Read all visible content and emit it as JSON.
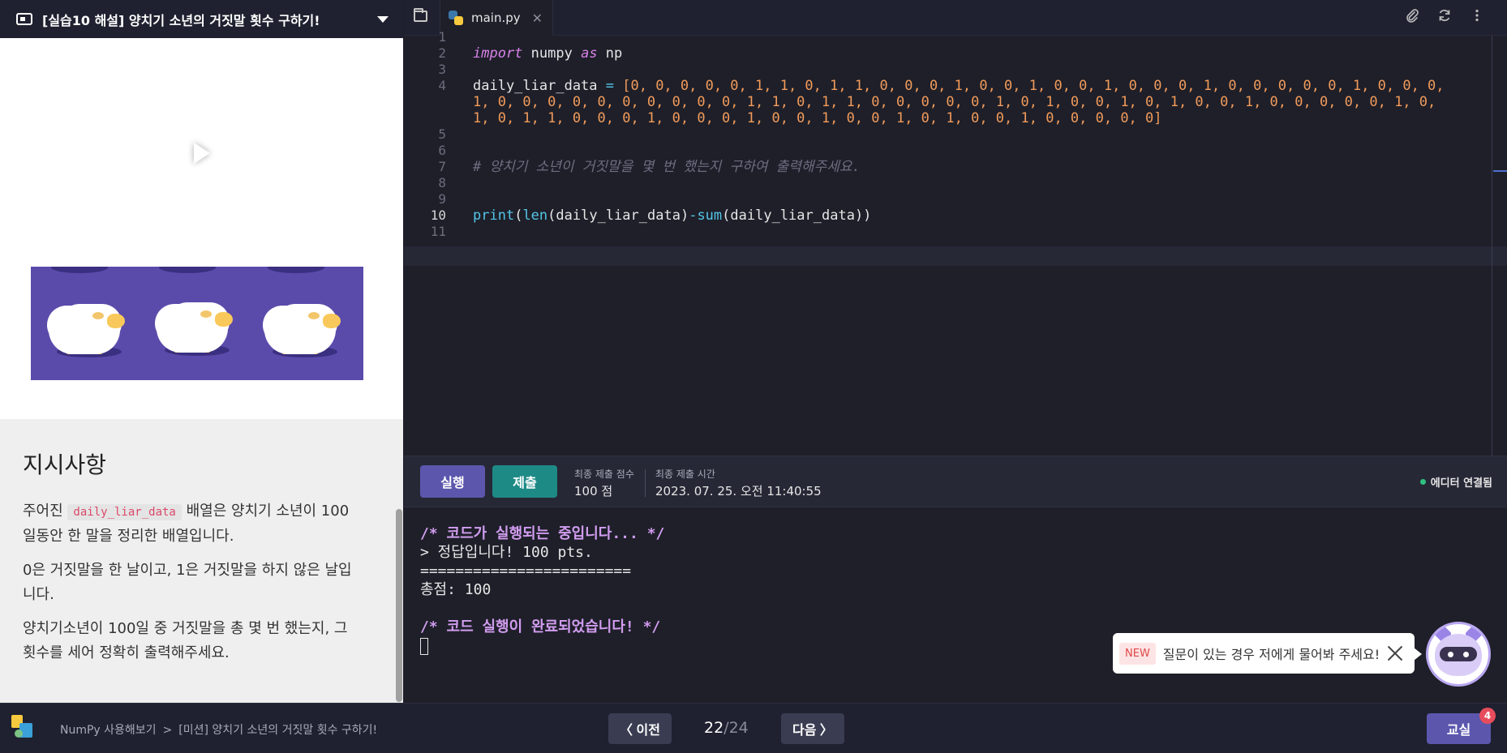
{
  "lesson": {
    "title": "[실습10 해설] 양치기 소년의 거짓말 횟수 구하기!"
  },
  "instructions": {
    "heading": "지시사항",
    "p1_before": "주어진",
    "p1_code": "daily_liar_data",
    "p1_after": "배열은 양치기 소년이 100일동안 한 말을 정리한 배열입니다.",
    "p2": "0은 거짓말을 한 날이고, 1은 거짓말을 하지 않은 날입니다.",
    "p3": "양치기소년이 100일 중 거짓말을 총 몇 번 했는지, 그 횟수를 세어 정확히 출력해주세요."
  },
  "editor": {
    "tab_label": "main.py",
    "tab_close": "✕",
    "line_numbers": [
      "1",
      "2",
      "3",
      "4",
      "5",
      "6",
      "7",
      "8",
      "9",
      "10",
      "11"
    ],
    "active_line": "10",
    "import_kw": "import",
    "module": " numpy ",
    "as_kw": "as",
    "alias": " np",
    "data_var": "daily_liar_data ",
    "assign_op": "=",
    "array_line1": " [0, 0, 0, 0, 0, 1, 1, 0, 1, 1, 0, 0, 0, 1, 0, 0, 1, 0, 0, 1, 0, 0, 0, 1, 0, 0, 0, 0, 0, 1, 0, 0, 0,",
    "array_line2": "1, 0, 0, 0, 0, 0, 0, 0, 0, 0, 0, 1, 1, 0, 1, 1, 0, 0, 0, 0, 0, 1, 0, 1, 0, 0, 1, 0, 1, 0, 0, 1, 0, 0, 0, 0, 0, 1, 0,",
    "array_line3": "1, 0, 1, 1, 0, 0, 0, 1, 0, 0, 0, 1, 0, 0, 1, 0, 0, 1, 0, 1, 0, 0, 1, 0, 0, 0, 0, 0]",
    "comment": "# 양치기 소년이 거짓말을 몇 번 했는지 구하여 출력해주세요.",
    "print_fn": "print",
    "len_fn": "len",
    "arg": "daily_liar_data",
    "minus": "-",
    "sum_fn": "sum"
  },
  "runbar": {
    "run_label": "실행",
    "submit_label": "제출",
    "score_label": "최종 제출 점수",
    "score_value": "100 점",
    "time_label": "최종 제출 시간",
    "time_value": "2023. 07. 25. 오전 11:40:55",
    "connection": "에디터 연결됨"
  },
  "console": {
    "lines": [
      "/* 코드가 실행되는 중입니다... */",
      "> 정답입니다! 100 pts.",
      "========================",
      "총점: 100",
      "",
      "/* 코드 실행이 완료되었습니다! */"
    ]
  },
  "help": {
    "badge": "NEW",
    "text": "질문이 있는 경우 저에게 물어봐 주세요!"
  },
  "footer": {
    "breadcrumb_course": "NumPy 사용해보기",
    "breadcrumb_sep": ">",
    "breadcrumb_lesson": "[미션] 양치기 소년의 거짓말 횟수 구하기!",
    "prev_label": "〈 이전",
    "page_current": "22",
    "page_total": "/24",
    "next_label": "다음 〉",
    "classroom_label": "교실",
    "classroom_badge": "4"
  },
  "colors": {
    "primary": "#5c57ad",
    "submit": "#1e8a86",
    "connected": "#2ec27e",
    "console_comment": "#d29df0"
  },
  "icons": [
    "lesson-icon",
    "chevron-down-icon",
    "play-icon",
    "folder-icon",
    "python-icon",
    "paperclip-icon",
    "refresh-icon",
    "more-vertical-icon",
    "close-icon"
  ]
}
